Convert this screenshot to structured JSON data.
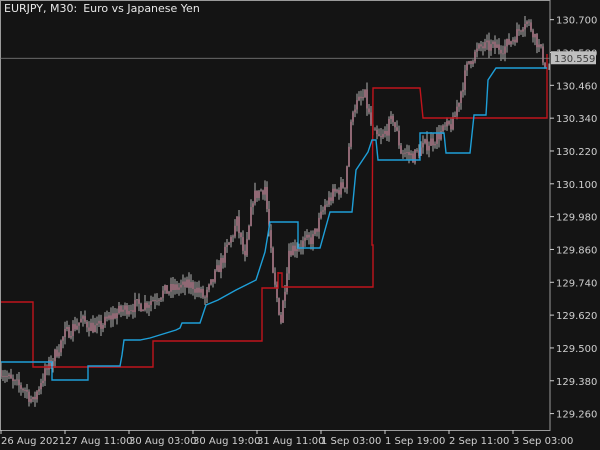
{
  "header": {
    "symbol_timeframe": "EURJPY, M30:",
    "description": "Euro vs Japanese Yen"
  },
  "colors": {
    "background": "#141414",
    "candle": "#e3a0b4",
    "candle_wick": "#d8d8d8",
    "upper_line": "#c0141c",
    "lower_line": "#1e9fd8",
    "axis": "#cfcfcf",
    "crosshair": "#888888",
    "price_label_bg": "#bfbfbf",
    "price_label_text": "#404040"
  },
  "chart_data": {
    "type": "candlestick",
    "title": "EURJPY, M30: Euro vs Japanese Yen",
    "ylim": [
      129.2,
      130.75
    ],
    "y_ticks": [
      "130.700",
      "130.580",
      "130.460",
      "130.340",
      "130.220",
      "130.100",
      "129.980",
      "129.860",
      "129.740",
      "129.620",
      "129.500",
      "129.380",
      "129.260"
    ],
    "current_price_label": "130.559",
    "x_ticks": [
      "26 Aug 2021",
      "27 Aug 11:00",
      "30 Aug 03:00",
      "30 Aug 19:00",
      "31 Aug 11:00",
      "1 Sep 03:00",
      "1 Sep 19:00",
      "2 Sep 11:00",
      "3 Sep 03:00"
    ],
    "x_tick_index": [
      0,
      32,
      64,
      96,
      128,
      160,
      192,
      224,
      256
    ],
    "close_anchors": [
      [
        0,
        129.42
      ],
      [
        6,
        129.37
      ],
      [
        12,
        129.35
      ],
      [
        16,
        129.3
      ],
      [
        20,
        129.38
      ],
      [
        26,
        129.46
      ],
      [
        32,
        129.55
      ],
      [
        40,
        129.6
      ],
      [
        48,
        129.57
      ],
      [
        56,
        129.62
      ],
      [
        64,
        129.65
      ],
      [
        72,
        129.66
      ],
      [
        80,
        129.7
      ],
      [
        88,
        129.72
      ],
      [
        96,
        129.73
      ],
      [
        102,
        129.68
      ],
      [
        108,
        129.78
      ],
      [
        114,
        129.88
      ],
      [
        118,
        129.96
      ],
      [
        122,
        129.82
      ],
      [
        126,
        130.05
      ],
      [
        132,
        130.09
      ],
      [
        136,
        129.76
      ],
      [
        140,
        129.6
      ],
      [
        144,
        129.86
      ],
      [
        150,
        129.88
      ],
      [
        156,
        129.9
      ],
      [
        162,
        130.02
      ],
      [
        166,
        130.06
      ],
      [
        172,
        130.1
      ],
      [
        176,
        130.38
      ],
      [
        182,
        130.42
      ],
      [
        186,
        130.28
      ],
      [
        190,
        130.26
      ],
      [
        196,
        130.34
      ],
      [
        200,
        130.22
      ],
      [
        206,
        130.2
      ],
      [
        212,
        130.24
      ],
      [
        216,
        130.26
      ],
      [
        222,
        130.3
      ],
      [
        226,
        130.32
      ],
      [
        230,
        130.44
      ],
      [
        234,
        130.55
      ],
      [
        240,
        130.6
      ],
      [
        246,
        130.6
      ],
      [
        252,
        130.6
      ],
      [
        258,
        130.65
      ],
      [
        262,
        130.7
      ],
      [
        266,
        130.66
      ],
      [
        270,
        130.58
      ],
      [
        273,
        130.52
      ]
    ],
    "upper_channel": [
      [
        0,
        129.63
      ],
      [
        16,
        129.42
      ],
      [
        78,
        129.42
      ],
      [
        78,
        129.38
      ],
      [
        152,
        129.38
      ],
      [
        152,
        129.68
      ],
      [
        212,
        129.68
      ],
      [
        212,
        129.68
      ],
      [
        240,
        129.68
      ],
      [
        240,
        129.68
      ],
      [
        268,
        129.68
      ],
      [
        268,
        130.16
      ],
      [
        275,
        130.16
      ]
    ],
    "upper_channel_full": [
      [
        0,
        129.64
      ],
      [
        16,
        129.64
      ],
      [
        16,
        129.42
      ],
      [
        78,
        129.42
      ],
      [
        78,
        129.38
      ],
      [
        152,
        129.38
      ],
      [
        152,
        129.69
      ],
      [
        272,
        129.69
      ],
      [
        272,
        130.16
      ],
      [
        280,
        130.16
      ]
    ],
    "lower_channel": [
      [
        0,
        129.4
      ],
      [
        30,
        129.4
      ],
      [
        30,
        129.33
      ],
      [
        48,
        129.33
      ],
      [
        48,
        129.35
      ],
      [
        60,
        129.35
      ],
      [
        62,
        129.38
      ],
      [
        100,
        129.39
      ],
      [
        110,
        129.44
      ],
      [
        120,
        129.48
      ],
      [
        126,
        129.5
      ],
      [
        140,
        129.53
      ],
      [
        152,
        129.55
      ],
      [
        164,
        129.58
      ],
      [
        178,
        129.59
      ],
      [
        190,
        129.62
      ],
      [
        196,
        129.63
      ],
      [
        204,
        129.7
      ],
      [
        216,
        129.72
      ],
      [
        226,
        129.74
      ],
      [
        232,
        129.76
      ],
      [
        240,
        129.8
      ],
      [
        248,
        129.8
      ],
      [
        254,
        129.86
      ],
      [
        256,
        129.9
      ],
      [
        266,
        129.9
      ],
      [
        266,
        129.85
      ],
      [
        272,
        129.85
      ],
      [
        290,
        129.85
      ],
      [
        298,
        129.94
      ],
      [
        306,
        129.94
      ],
      [
        312,
        130.01
      ],
      [
        326,
        130.01
      ],
      [
        328,
        130.17
      ],
      [
        338,
        130.18
      ],
      [
        345,
        130.26
      ],
      [
        366,
        130.26
      ],
      [
        372,
        130.25
      ],
      [
        398,
        130.25
      ],
      [
        404,
        130.36
      ],
      [
        420,
        130.4
      ],
      [
        424,
        130.49
      ],
      [
        436,
        130.52
      ],
      [
        450,
        130.57
      ]
    ]
  }
}
